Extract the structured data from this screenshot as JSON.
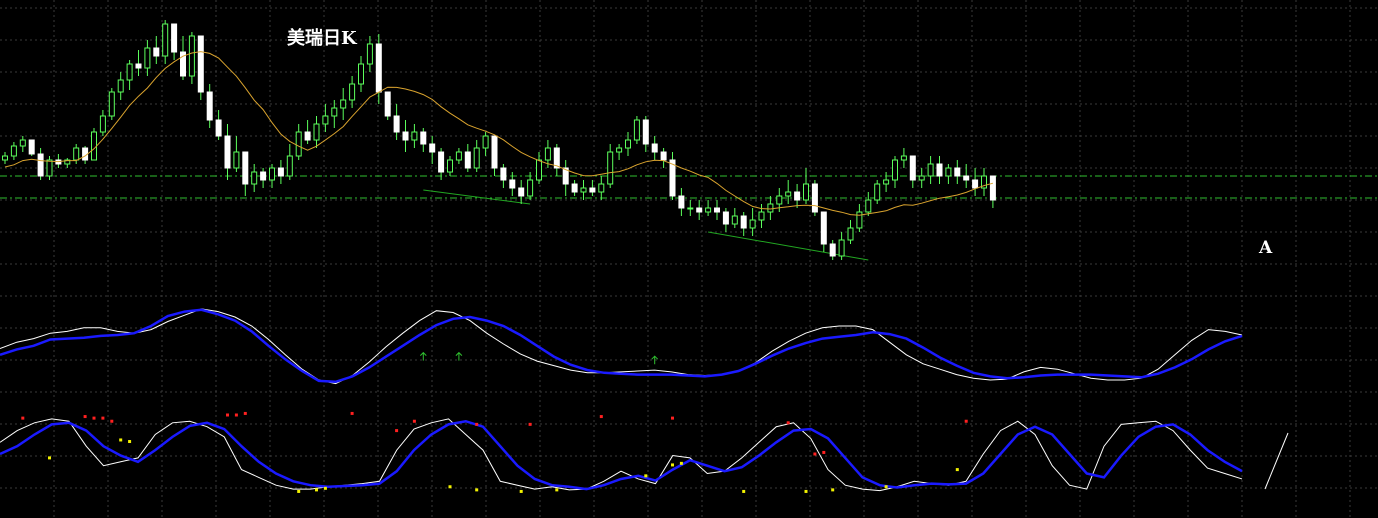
{
  "chart_data": {
    "type": "line",
    "title": "美瑞日K",
    "mark_label": "A",
    "grid": true,
    "colors": {
      "background": "#000000",
      "grid": "#3a3a3a",
      "candle": "#5cff5c",
      "ma": "#d9a32e",
      "support": "#2fbf2f",
      "trendline": "#22a722",
      "fast": "#ffffff",
      "slow": "#1a1aff",
      "dot_top": "#ff2020",
      "dot_bottom": "#f2f200"
    },
    "price": {
      "ylim": [
        0,
        100
      ],
      "support_levels": [
        62,
        51
      ],
      "candles": [
        [
          70,
          74,
          68,
          72
        ],
        [
          72,
          79,
          70,
          77
        ],
        [
          77,
          82,
          74,
          80
        ],
        [
          80,
          80,
          72,
          73
        ],
        [
          73,
          76,
          60,
          62
        ],
        [
          62,
          72,
          60,
          70
        ],
        [
          70,
          73,
          66,
          68
        ],
        [
          68,
          71,
          66,
          70
        ],
        [
          70,
          78,
          68,
          76
        ],
        [
          76,
          77,
          68,
          70
        ],
        [
          70,
          86,
          70,
          84
        ],
        [
          84,
          95,
          82,
          92
        ],
        [
          92,
          106,
          90,
          104
        ],
        [
          104,
          114,
          100,
          110
        ],
        [
          110,
          120,
          105,
          118
        ],
        [
          118,
          125,
          112,
          116
        ],
        [
          116,
          130,
          112,
          126
        ],
        [
          126,
          132,
          118,
          122
        ],
        [
          122,
          140,
          118,
          138
        ],
        [
          138,
          136,
          120,
          124
        ],
        [
          124,
          132,
          110,
          112
        ],
        [
          112,
          134,
          108,
          132
        ],
        [
          132,
          128,
          100,
          104
        ],
        [
          104,
          108,
          86,
          90
        ],
        [
          90,
          95,
          80,
          82
        ],
        [
          82,
          88,
          60,
          66
        ],
        [
          66,
          82,
          64,
          74
        ],
        [
          74,
          73,
          52,
          58
        ],
        [
          58,
          68,
          54,
          64
        ],
        [
          64,
          66,
          56,
          60
        ],
        [
          60,
          68,
          56,
          66
        ],
        [
          66,
          70,
          58,
          62
        ],
        [
          62,
          78,
          60,
          72
        ],
        [
          72,
          88,
          70,
          84
        ],
        [
          84,
          90,
          78,
          80
        ],
        [
          80,
          92,
          76,
          88
        ],
        [
          88,
          98,
          84,
          92
        ],
        [
          92,
          100,
          86,
          96
        ],
        [
          96,
          106,
          90,
          100
        ],
        [
          100,
          112,
          96,
          108
        ],
        [
          108,
          122,
          104,
          118
        ],
        [
          118,
          132,
          114,
          128
        ],
        [
          128,
          133,
          98,
          104
        ],
        [
          104,
          104,
          90,
          92
        ],
        [
          92,
          98,
          80,
          84
        ],
        [
          84,
          90,
          74,
          80
        ],
        [
          80,
          88,
          76,
          84
        ],
        [
          84,
          86,
          74,
          78
        ],
        [
          78,
          82,
          68,
          74
        ],
        [
          74,
          76,
          60,
          64
        ],
        [
          64,
          72,
          62,
          70
        ],
        [
          70,
          76,
          68,
          74
        ],
        [
          74,
          78,
          64,
          66
        ],
        [
          66,
          80,
          64,
          76
        ],
        [
          76,
          84,
          72,
          82
        ],
        [
          82,
          82,
          62,
          66
        ],
        [
          66,
          68,
          56,
          60
        ],
        [
          60,
          64,
          52,
          56
        ],
        [
          56,
          60,
          48,
          52
        ],
        [
          52,
          64,
          50,
          60
        ],
        [
          60,
          74,
          58,
          70
        ],
        [
          70,
          80,
          66,
          76
        ],
        [
          76,
          78,
          62,
          66
        ],
        [
          66,
          70,
          52,
          58
        ],
        [
          58,
          60,
          52,
          54
        ],
        [
          54,
          60,
          50,
          56
        ],
        [
          56,
          60,
          52,
          54
        ],
        [
          54,
          62,
          50,
          58
        ],
        [
          58,
          78,
          56,
          74
        ],
        [
          74,
          78,
          70,
          76
        ],
        [
          76,
          84,
          72,
          80
        ],
        [
          80,
          92,
          78,
          90
        ],
        [
          90,
          92,
          74,
          78
        ],
        [
          78,
          82,
          70,
          74
        ],
        [
          74,
          76,
          66,
          70
        ],
        [
          70,
          74,
          50,
          52
        ],
        [
          52,
          56,
          42,
          46
        ],
        [
          46,
          50,
          42,
          46
        ],
        [
          46,
          50,
          40,
          44
        ],
        [
          44,
          50,
          42,
          46
        ],
        [
          46,
          50,
          40,
          44
        ],
        [
          44,
          46,
          34,
          38
        ],
        [
          38,
          46,
          36,
          42
        ],
        [
          42,
          44,
          32,
          36
        ],
        [
          36,
          46,
          32,
          40
        ],
        [
          40,
          48,
          36,
          44
        ],
        [
          44,
          52,
          40,
          48
        ],
        [
          48,
          56,
          44,
          52
        ],
        [
          52,
          60,
          48,
          54
        ],
        [
          54,
          58,
          46,
          50
        ],
        [
          50,
          66,
          48,
          58
        ],
        [
          58,
          60,
          42,
          44
        ],
        [
          44,
          42,
          24,
          28
        ],
        [
          28,
          30,
          20,
          22
        ],
        [
          22,
          34,
          20,
          30
        ],
        [
          30,
          40,
          28,
          36
        ],
        [
          36,
          48,
          34,
          44
        ],
        [
          44,
          54,
          42,
          50
        ],
        [
          50,
          60,
          48,
          58
        ],
        [
          58,
          64,
          54,
          60
        ],
        [
          60,
          72,
          56,
          70
        ],
        [
          70,
          76,
          66,
          72
        ],
        [
          72,
          72,
          56,
          60
        ],
        [
          60,
          66,
          56,
          62
        ],
        [
          62,
          72,
          58,
          68
        ],
        [
          68,
          72,
          58,
          62
        ],
        [
          62,
          68,
          58,
          66
        ],
        [
          66,
          70,
          58,
          62
        ],
        [
          62,
          68,
          56,
          60
        ],
        [
          60,
          66,
          52,
          56
        ],
        [
          56,
          66,
          52,
          62
        ],
        [
          62,
          60,
          46,
          50
        ]
      ],
      "ma": [
        66.5,
        67.6,
        69.7,
        70.4,
        69.7,
        69.4,
        69.2,
        69.7,
        69.7,
        72.0,
        75.6,
        80.4,
        85.8,
        91.4,
        97.3,
        101.9,
        106.0,
        111.3,
        115.8,
        119.1,
        121.9,
        123.5,
        124.2,
        123.3,
        121.0,
        116.4,
        111.9,
        106.1,
        99.9,
        95.2,
        88.7,
        82.9,
        79.3,
        76.9,
        74.9,
        76.9,
        80.0,
        83.2,
        86.7,
        91.8,
        96.6,
        101.5,
        103.9,
        106.4,
        106.3,
        105.5,
        104.3,
        102.7,
        100.3,
        96.6,
        93.4,
        90.6,
        87.6,
        85.9,
        84.4,
        82.6,
        80.1,
        76.8,
        73.8,
        71.6,
        69.7,
        68.1,
        67.1,
        65.2,
        63.5,
        62.2,
        62.1,
        62.9,
        63.7,
        64.2,
        65.6,
        67.6,
        69.1,
        69.9,
        69.7,
        67.9,
        66.0,
        64.4,
        62.5,
        61.3,
        58.3,
        54.8,
        52.0,
        49.2,
        46.8,
        45.7,
        45.5,
        46.1,
        46.6,
        47.2,
        47.4,
        47.2,
        46.0,
        44.8,
        43.9,
        42.7,
        42.4,
        43.1,
        43.8,
        44.6,
        46.3,
        47.6,
        47.4,
        48.4,
        49.7,
        50.9,
        51.6,
        52.5,
        53.8,
        55.6,
        57.2,
        58.4
      ],
      "trendlines": [
        {
          "from": [
            47,
            55
          ],
          "to": [
            59,
            48
          ]
        },
        {
          "from": [
            79,
            34
          ],
          "to": [
            97,
            20
          ]
        }
      ]
    },
    "indicator_1": {
      "ylim": [
        0,
        100
      ],
      "fast": [
        55,
        62,
        66,
        72,
        74,
        78,
        78,
        74,
        72,
        76,
        85,
        92,
        99,
        96,
        90,
        80,
        65,
        48,
        32,
        20,
        16,
        25,
        40,
        57,
        72,
        86,
        97,
        95,
        86,
        72,
        60,
        49,
        41,
        36,
        31,
        28,
        28,
        29,
        30,
        31,
        29,
        26,
        25,
        26,
        30,
        39,
        52,
        63,
        72,
        78,
        80,
        80,
        76,
        62,
        48,
        38,
        32,
        26,
        22,
        20,
        21,
        29,
        34,
        32,
        27,
        22,
        20,
        20,
        22,
        32,
        48,
        64,
        76,
        74,
        70
      ],
      "slow": [
        48,
        54,
        58,
        65,
        66,
        67,
        69,
        70,
        72,
        80,
        91,
        96,
        98,
        93,
        86,
        74,
        58,
        43,
        30,
        19,
        18,
        24,
        34,
        46,
        58,
        70,
        81,
        88,
        90,
        86,
        80,
        70,
        58,
        46,
        37,
        31,
        28,
        27,
        26,
        26,
        26,
        25,
        24,
        26,
        30,
        38,
        47,
        55,
        61,
        66,
        68,
        70,
        73,
        71,
        66,
        56,
        45,
        36,
        28,
        24,
        22,
        23,
        25,
        26,
        26,
        26,
        25,
        24,
        23,
        27,
        34,
        43,
        54,
        63,
        69
      ]
    },
    "indicator_2": {
      "ylim": [
        0,
        100
      ],
      "fast": [
        65,
        80,
        90,
        95,
        92,
        60,
        35,
        40,
        45,
        75,
        90,
        92,
        85,
        72,
        30,
        20,
        10,
        5,
        5,
        8,
        10,
        12,
        15,
        55,
        82,
        90,
        95,
        75,
        55,
        15,
        10,
        5,
        8,
        4,
        5,
        15,
        28,
        18,
        12,
        48,
        45,
        25,
        28,
        45,
        65,
        85,
        90,
        70,
        30,
        10,
        5,
        3,
        8,
        15,
        12,
        10,
        15,
        50,
        80,
        92,
        75,
        35,
        10,
        5,
        60,
        88,
        90,
        92,
        80,
        55,
        32,
        25,
        18
      ],
      "slow": [
        50,
        60,
        75,
        88,
        90,
        80,
        60,
        48,
        40,
        55,
        72,
        86,
        90,
        82,
        60,
        40,
        25,
        15,
        10,
        8,
        9,
        10,
        12,
        28,
        55,
        75,
        88,
        92,
        85,
        60,
        35,
        18,
        10,
        8,
        5,
        10,
        18,
        22,
        16,
        30,
        42,
        35,
        28,
        33,
        48,
        65,
        80,
        82,
        70,
        45,
        20,
        10,
        7,
        10,
        12,
        11,
        12,
        25,
        50,
        75,
        85,
        75,
        50,
        25,
        20,
        48,
        72,
        85,
        88,
        75,
        55,
        40,
        28
      ],
      "dots_top": [
        [
          2,
          96
        ],
        [
          9,
          98
        ],
        [
          10,
          96
        ],
        [
          11,
          96
        ],
        [
          12,
          92
        ],
        [
          25,
          100
        ],
        [
          26,
          100
        ],
        [
          27,
          102
        ],
        [
          39,
          102
        ],
        [
          44,
          80
        ],
        [
          46,
          92
        ],
        [
          53,
          88
        ],
        [
          59,
          88
        ],
        [
          67,
          98
        ],
        [
          75,
          96
        ],
        [
          88,
          90
        ],
        [
          91,
          50
        ],
        [
          92,
          52
        ],
        [
          108,
          92
        ]
      ],
      "dots_bottom": [
        [
          5,
          45
        ],
        [
          13,
          68
        ],
        [
          14,
          66
        ],
        [
          33,
          2
        ],
        [
          35,
          4
        ],
        [
          36,
          6
        ],
        [
          50,
          8
        ],
        [
          53,
          4
        ],
        [
          58,
          2
        ],
        [
          62,
          4
        ],
        [
          72,
          22
        ],
        [
          75,
          36
        ],
        [
          76,
          38
        ],
        [
          83,
          2
        ],
        [
          90,
          2
        ],
        [
          93,
          4
        ],
        [
          99,
          8
        ],
        [
          107,
          30
        ]
      ],
      "arrows": [
        [
          47,
          46
        ],
        [
          51,
          46
        ],
        [
          73,
          42
        ]
      ]
    }
  }
}
